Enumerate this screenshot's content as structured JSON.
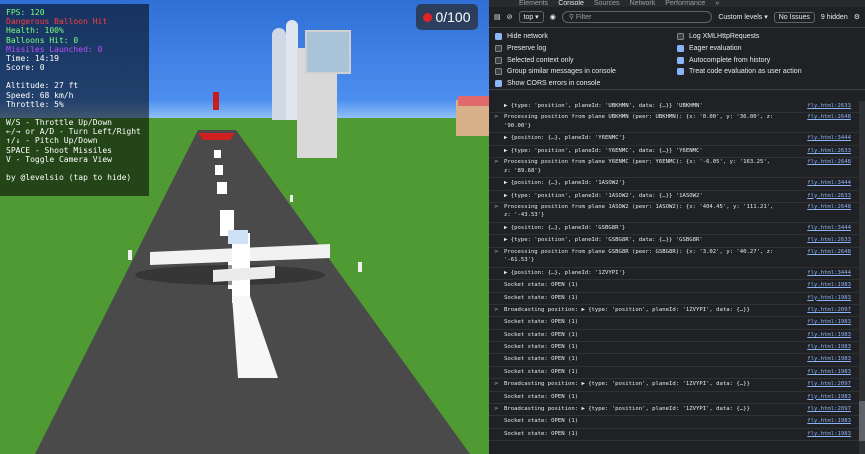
{
  "game": {
    "hud": {
      "fps": "FPS: 120",
      "warning": "Dangerous Balloon Hit",
      "health": "Health: 100%",
      "balloons": "Balloons Hit: 0",
      "missile": "Missiles Launched: 0",
      "time": "Time: 14:19",
      "score": "Score: 0",
      "altitude": "Altitude: 27 ft",
      "speed": "Speed: 68 km/h",
      "throttle": "Throttle: 5%",
      "controls": [
        "W/S - Throttle Up/Down",
        "←/→ or A/D - Turn Left/Right",
        "↑/↓ - Pitch Up/Down",
        "SPACE - Shoot Missiles",
        "V - Toggle Camera View"
      ],
      "credit": "by @levelsio (tap to hide)"
    },
    "score_counter": "0/100"
  },
  "devtools": {
    "tabs": [
      "Elements",
      "Console",
      "Sources",
      "Network",
      "Performance",
      "»"
    ],
    "active_tab": "Console",
    "toolbar": {
      "context": "top ▾",
      "filter_placeholder": "Filter",
      "levels": "Custom levels ▾",
      "issues": "No Issues",
      "hidden": "9 hidden"
    },
    "settings": [
      {
        "label": "Hide network",
        "checked": true
      },
      {
        "label": "Log XMLHttpRequests",
        "checked": false
      },
      {
        "label": "Preserve log",
        "checked": false
      },
      {
        "label": "Eager evaluation",
        "checked": true
      },
      {
        "label": "Selected context only",
        "checked": false
      },
      {
        "label": "Autocomplete from history",
        "checked": true
      },
      {
        "label": "Group similar messages in console",
        "checked": false
      },
      {
        "label": "Treat code evaluation as user action",
        "checked": true
      },
      {
        "label": "Show CORS errors in console",
        "checked": true
      }
    ],
    "log": [
      {
        "text": "▶ {type: 'position', planeId: 'UBKHMN', data: {…}} 'UBKHMN'",
        "src": "fly.html:2633",
        "double": false
      },
      {
        "text": "Processing position from plane UBKHMN (peer: UBKHMN): {x: '0.00', y: '36.00', z: '90.00'}",
        "src": "fly.html:2648",
        "double": true
      },
      {
        "text": "▶ {position: {…}, planeId: 'Y6ENMC'}",
        "src": "fly.html:3444",
        "double": false
      },
      {
        "text": "▶ {type: 'position', planeId: 'Y6ENMC', data: {…}} 'Y6ENMC'",
        "src": "fly.html:2633",
        "double": false
      },
      {
        "text": "Processing position from plane Y6ENMC (peer: Y6ENMC): {x: '-6.05', y: '163.25', z: '89.68'}",
        "src": "fly.html:2648",
        "double": true
      },
      {
        "text": "▶ {position: {…}, planeId: '1ASOW2'}",
        "src": "fly.html:3444",
        "double": false
      },
      {
        "text": "▶ {type: 'position', planeId: '1ASOW2', data: {…}} '1ASOW2'",
        "src": "fly.html:2633",
        "double": false
      },
      {
        "text": "Processing position from plane 1ASOW2 (peer: 1ASOW2): {x: '404.45', y: '111.21', z: '-43.53'}",
        "src": "fly.html:2648",
        "double": true
      },
      {
        "text": "▶ {position: {…}, planeId: 'GSBG8R'}",
        "src": "fly.html:3444",
        "double": false
      },
      {
        "text": "▶ {type: 'position', planeId: 'GSBG8R', data: {…}} 'GSBG8R'",
        "src": "fly.html:2633",
        "double": false
      },
      {
        "text": "Processing position from plane GSBG8R (peer: GSBG8R): {x: '3.02', y: '40.27', z: '-61.53'}",
        "src": "fly.html:2648",
        "double": true
      },
      {
        "text": "▶ {position: {…}, planeId: '1ZVYPI'}",
        "src": "fly.html:3444",
        "double": false
      },
      {
        "text": "Socket state: OPEN (1)",
        "src": "fly.html:1983",
        "double": false
      },
      {
        "text": "Socket state: OPEN (1)",
        "src": "fly.html:1983",
        "double": false
      },
      {
        "text": "Broadcasting position: ▶ {type: 'position', planeId: '1ZVYPI', data: {…}}",
        "src": "fly.html:2097",
        "double": false
      },
      {
        "text": "Socket state: OPEN (1)",
        "src": "fly.html:1983",
        "double": false
      },
      {
        "text": "Socket state: OPEN (1)",
        "src": "fly.html:1983",
        "double": false
      },
      {
        "text": "Socket state: OPEN (1)",
        "src": "fly.html:1983",
        "double": false
      },
      {
        "text": "Socket state: OPEN (1)",
        "src": "fly.html:1983",
        "double": false
      },
      {
        "text": "Socket state: OPEN (1)",
        "src": "fly.html:1983",
        "double": false
      },
      {
        "text": "Broadcasting position: ▶ {type: 'position', planeId: '1ZVYPI', data: {…}}",
        "src": "fly.html:2097",
        "double": false
      },
      {
        "text": "Socket state: OPEN (1)",
        "src": "fly.html:1983",
        "double": false
      },
      {
        "text": "Broadcasting position: ▶ {type: 'position', planeId: '1ZVYPI', data: {…}}",
        "src": "fly.html:2097",
        "double": false
      },
      {
        "text": "Socket state: OPEN (1)",
        "src": "fly.html:1983",
        "double": false
      },
      {
        "text": "Socket state: OPEN (1)",
        "src": "fly.html:1983",
        "double": false
      }
    ]
  }
}
